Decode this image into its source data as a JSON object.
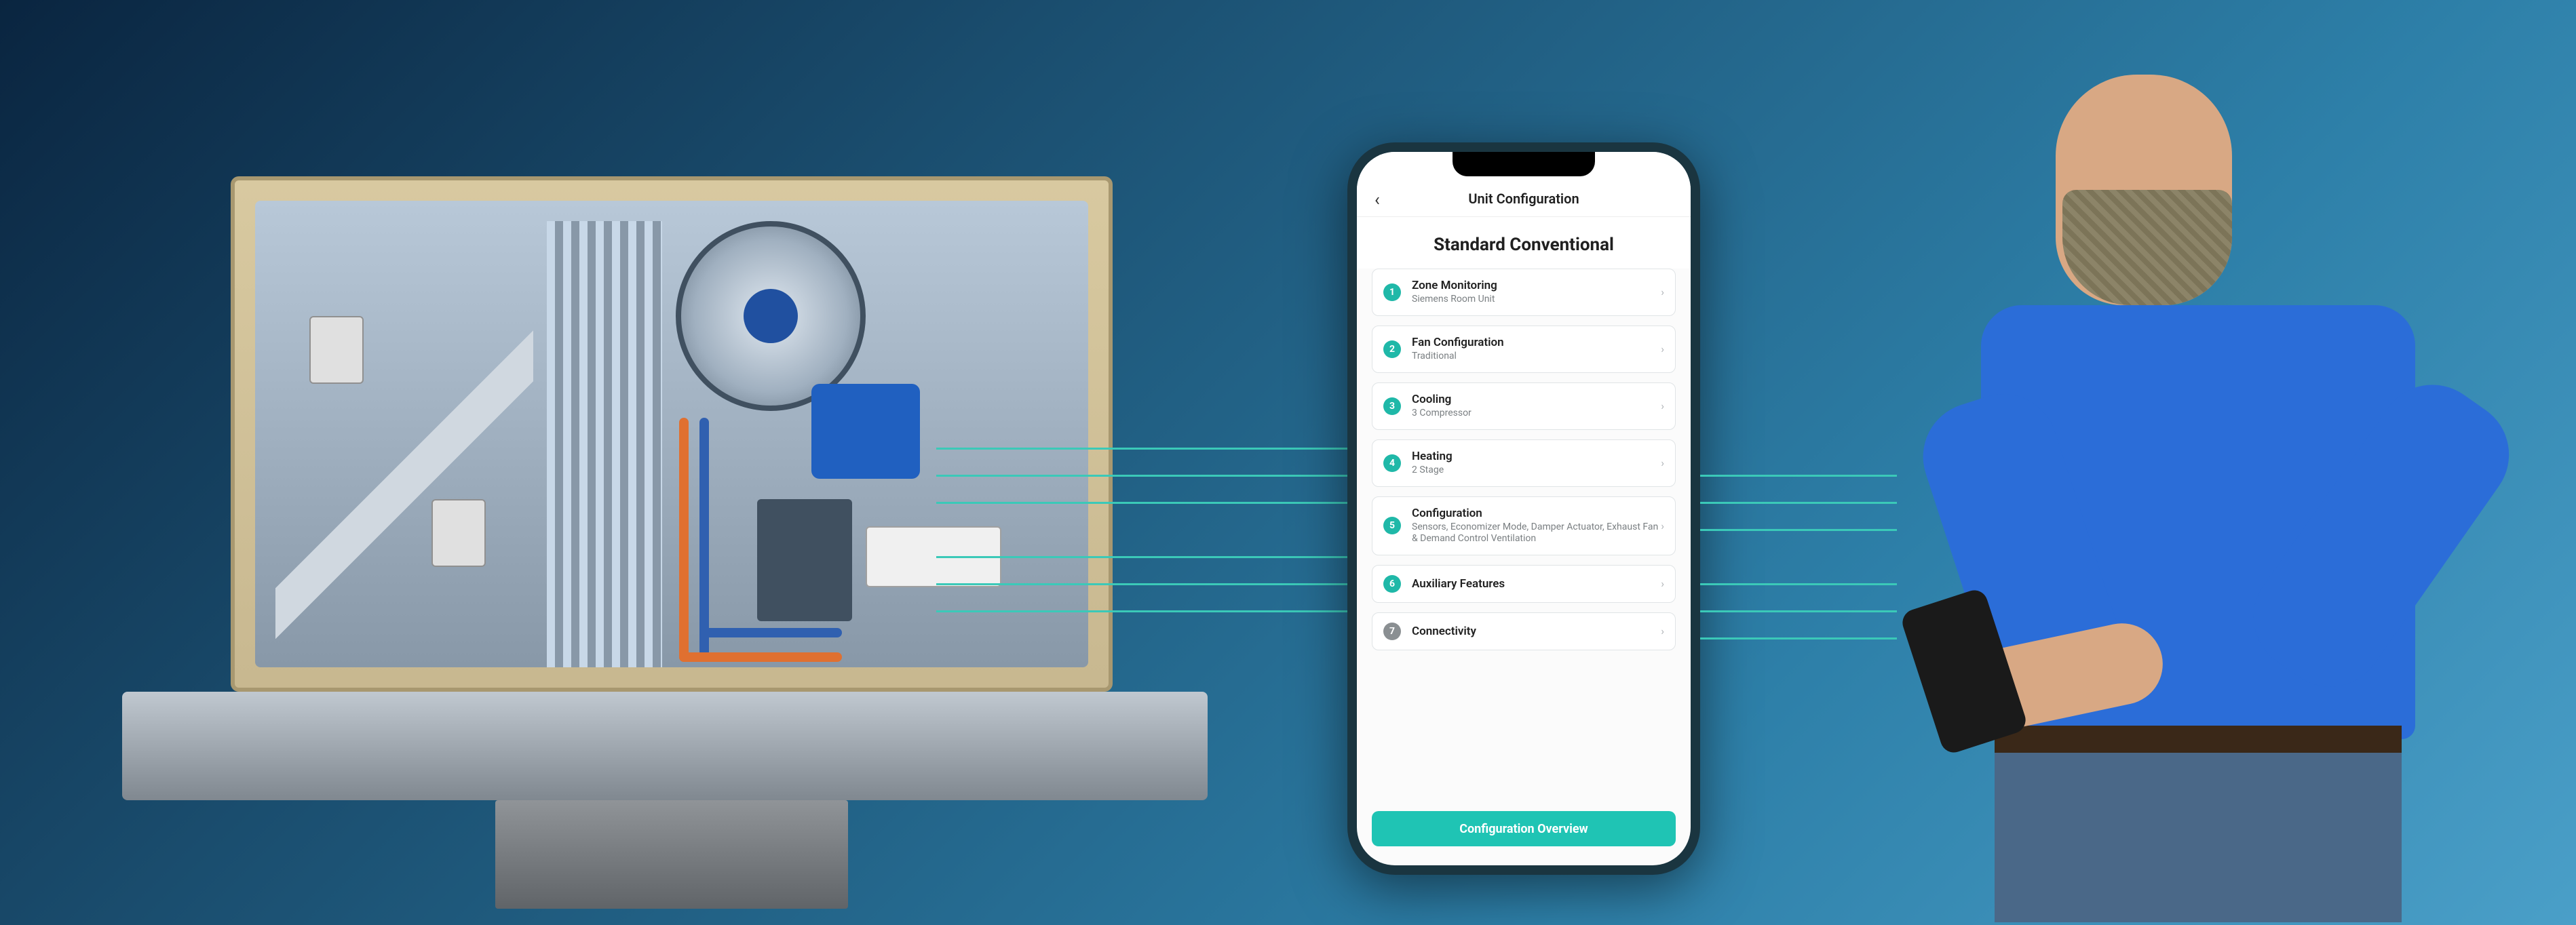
{
  "phone": {
    "header_title": "Unit Configuration",
    "subtitle": "Standard Conventional",
    "items": [
      {
        "num": "1",
        "num_grey": false,
        "label": "Zone Monitoring",
        "sublabel": "Siemens Room Unit"
      },
      {
        "num": "2",
        "num_grey": false,
        "label": "Fan Configuration",
        "sublabel": "Traditional"
      },
      {
        "num": "3",
        "num_grey": false,
        "label": "Cooling",
        "sublabel": "3 Compressor"
      },
      {
        "num": "4",
        "num_grey": false,
        "label": "Heating",
        "sublabel": "2 Stage"
      },
      {
        "num": "5",
        "num_grey": false,
        "label": "Configuration",
        "sublabel": "Sensors, Economizer Mode, Damper Actuator, Exhaust Fan & Demand Control Ventilation"
      },
      {
        "num": "6",
        "num_grey": false,
        "label": "Auxiliary Features",
        "sublabel": ""
      },
      {
        "num": "7",
        "num_grey": true,
        "label": "Connectivity",
        "sublabel": ""
      }
    ],
    "cta": "Configuration Overview"
  },
  "colors": {
    "accent": "#1fc4b4",
    "connection_line": "#3bc9b8",
    "shirt": "#2b6dd8"
  }
}
